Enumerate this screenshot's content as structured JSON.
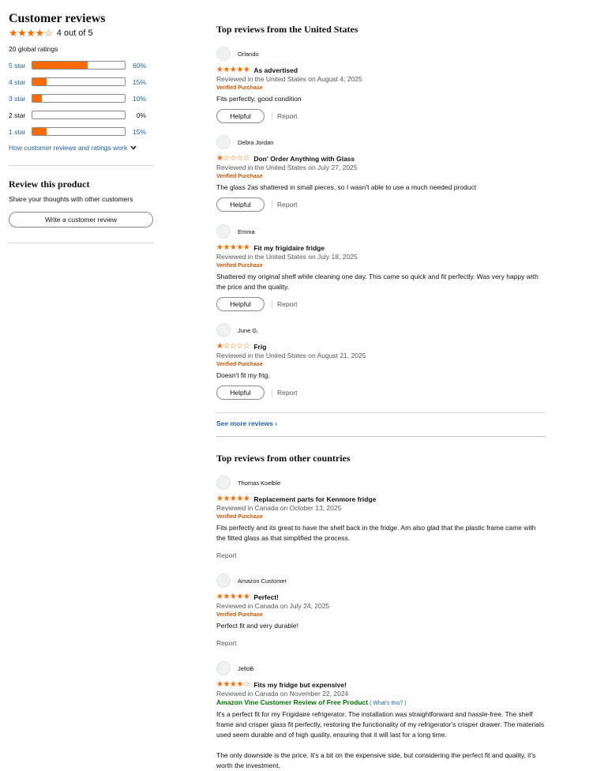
{
  "summary": {
    "title": "Customer reviews",
    "stars": "★★★★☆",
    "average_text": "4 out of 5",
    "global_ratings": "20 global ratings",
    "histogram": [
      {
        "label": "5 star",
        "percent_text": "60%",
        "percent": 60,
        "link": true
      },
      {
        "label": "4 star",
        "percent_text": "15%",
        "percent": 15,
        "link": true
      },
      {
        "label": "3 star",
        "percent_text": "10%",
        "percent": 10,
        "link": true
      },
      {
        "label": "2 star",
        "percent_text": "0%",
        "percent": 0,
        "link": false
      },
      {
        "label": "1 star",
        "percent_text": "15%",
        "percent": 15,
        "link": true
      }
    ],
    "how_link": "How customer reviews and ratings work",
    "review_product_title": "Review this product",
    "share_text": "Share your thoughts with other customers",
    "write_review_label": "Write a customer review"
  },
  "us_section": {
    "title": "Top reviews from the United States",
    "reviews": [
      {
        "name": "Orlando",
        "stars": "★★★★★",
        "title": "As advertised",
        "date": "Reviewed in the United States on August 4, 2025",
        "badge": "Verified Purchase",
        "body": "Fits perfectly, good condition",
        "helpful": "Helpful",
        "report": "Report"
      },
      {
        "name": "Debra Jordan",
        "stars": "★☆☆☆☆",
        "title": "Don' Order Anything with Glass",
        "date": "Reviewed in the United States on July 27, 2025",
        "badge": "Verified Purchase",
        "body": "The glass 2as shattered in small pieces, so I wasn't able to use a much needed product",
        "helpful": "Helpful",
        "report": "Report"
      },
      {
        "name": "Emma",
        "stars": "★★★★★",
        "title": "Fit my frigidaire fridge",
        "date": "Reviewed in the United States on July 18, 2025",
        "badge": "Verified Purchase",
        "body": "Shattered my original shelf while cleaning one day. This came so quick and fit perfectly. Was very happy with the price and the quality.",
        "helpful": "Helpful",
        "report": "Report"
      },
      {
        "name": "June G.",
        "stars": "★☆☆☆☆",
        "title": "Frig",
        "date": "Reviewed in the United States on August 21, 2025",
        "badge": "Verified Purchase",
        "body": "Doesn't fit my frig.",
        "helpful": "Helpful",
        "report": "Report"
      }
    ],
    "see_more": "See more reviews ›"
  },
  "other_section": {
    "title": "Top reviews from other countries",
    "reviews": [
      {
        "name": "Thomas Koelble",
        "stars": "★★★★★",
        "title": "Replacement parts for Kenmore fridge",
        "date": "Reviewed in Canada on October 13, 2025",
        "badge": "Verified Purchase",
        "body": "Fits perfectly and its great to have the shelf back in the fridge. Am also glad that the plastic frame came with the fitted glass as that simplified the process.",
        "report": "Report"
      },
      {
        "name": "Amazon Customer",
        "stars": "★★★★★",
        "title": "Perfect!",
        "date": "Reviewed in Canada on July 24, 2025",
        "badge": "Verified Purchase",
        "body": "Perfect fit and very durable!",
        "report": "Report"
      },
      {
        "name": "JelloB",
        "stars": "★★★★☆",
        "title": "Fits my fridge but expensive!",
        "date": "Reviewed in Canada on November 22, 2024",
        "vine_badge": "Amazon Vine Customer Review of Free Product",
        "vine_whats": "( What's this? )",
        "body": "It's a perfect fit for my Frigidaire refrigerator. The installation was straightforward and hassle-free. The shelf frame and crisper glass fit perfectly, restoring the functionality of my refrigerator's crisper drawer. The materials used seem durable and of high quality, ensuring that it will last for a long time.",
        "body2": "The only downside is the price. It's a bit on the expensive side, but considering the perfect fit and quality, it's worth the investment."
      }
    ]
  },
  "colors": {
    "star": "#ff6a00",
    "link": "#2162a1",
    "verified": "#c45500",
    "vine": "#007600"
  },
  "icons": {
    "chevron": "chevron-down-icon",
    "avatar": "avatar-icon"
  }
}
